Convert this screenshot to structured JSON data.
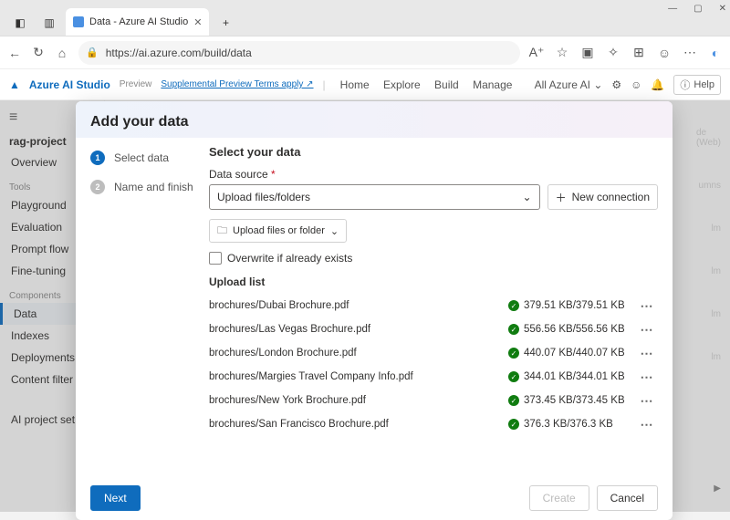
{
  "window": {
    "minimize": "—",
    "maximize": "▢",
    "close": "✕"
  },
  "tab": {
    "title": "Data - Azure AI Studio",
    "new": "+"
  },
  "addr": {
    "url": "https://ai.azure.com/build/data"
  },
  "app": {
    "brand": "Azure AI Studio",
    "badge": "Preview",
    "terms": "Supplemental Preview Terms apply ↗",
    "nav": {
      "home": "Home",
      "explore": "Explore",
      "build": "Build",
      "manage": "Manage"
    },
    "scope": "All Azure AI",
    "help": "Help"
  },
  "sidebar": {
    "project": "rag-project",
    "overview": "Overview",
    "tools_hdr": "Tools",
    "tools": {
      "playground": "Playground",
      "evaluation": "Evaluation",
      "pf": "Prompt flow",
      "ft": "Fine-tuning"
    },
    "components_hdr": "Components",
    "components": {
      "data": "Data",
      "indexes": "Indexes",
      "deployments": "Deployments",
      "cf": "Content filter"
    },
    "aiproj": "AI project set"
  },
  "phantom": {
    "p1": "de (Web)",
    "p2": "umns",
    "p3": "lm",
    "p4": "lm",
    "p5": "lm",
    "p6": "lm"
  },
  "modal": {
    "title": "Add your data",
    "step1": "Select data",
    "step2": "Name and finish",
    "heading": "Select your data",
    "ds_label": "Data source",
    "ds_value": "Upload files/folders",
    "newconn": "New connection",
    "upload_btn": "Upload files or folder",
    "overwrite": "Overwrite if already exists",
    "list_label": "Upload list",
    "rows": [
      {
        "name": "brochures/Dubai Brochure.pdf",
        "size": "379.51 KB/379.51 KB"
      },
      {
        "name": "brochures/Las Vegas Brochure.pdf",
        "size": "556.56 KB/556.56 KB"
      },
      {
        "name": "brochures/London Brochure.pdf",
        "size": "440.07 KB/440.07 KB"
      },
      {
        "name": "brochures/Margies Travel Company Info.pdf",
        "size": "344.01 KB/344.01 KB"
      },
      {
        "name": "brochures/New York Brochure.pdf",
        "size": "373.45 KB/373.45 KB"
      },
      {
        "name": "brochures/San Francisco Brochure.pdf",
        "size": "376.3 KB/376.3 KB"
      }
    ],
    "next": "Next",
    "create": "Create",
    "cancel": "Cancel"
  }
}
